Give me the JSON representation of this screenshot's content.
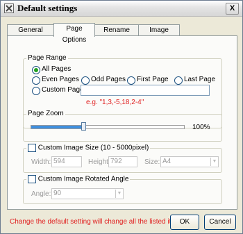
{
  "window": {
    "title": "Default settings",
    "close_label": "X"
  },
  "tabs": [
    {
      "label": "General Options"
    },
    {
      "label": "Page Options"
    },
    {
      "label": "Rename Options"
    },
    {
      "label": "Image Options"
    }
  ],
  "page_range": {
    "title": "Page Range",
    "options": {
      "all_pages": "All Pages",
      "even_pages": "Even Pages",
      "odd_pages": "Odd Pages",
      "first_page": "First Page",
      "last_page": "Last Page",
      "custom_pages": "Custom Pages"
    },
    "selected": "all_pages",
    "custom_value": "",
    "hint": "e.g. \"1,3,-5,18,2-4\""
  },
  "page_zoom": {
    "title": "Page Zoom",
    "value": 100,
    "value_label": "100%"
  },
  "custom_image_size": {
    "title": "Custom Image Size (10 - 5000pixel)",
    "checked": false,
    "width_label": "Width:",
    "width_value": "594",
    "height_label": "Height:",
    "height_value": "792",
    "size_label": "Size:",
    "size_value": "A4"
  },
  "custom_rotated_angle": {
    "title": "Custom Image Rotated Angle",
    "checked": false,
    "angle_label": "Angle:",
    "angle_value": "90"
  },
  "footer": {
    "message": "Change the default setting will change all the listed items.",
    "ok_label": "OK",
    "cancel_label": "Cancel"
  },
  "colors": {
    "accent": "#3f8fdf",
    "warning_text": "#e02020",
    "radio_selected": "#21a121"
  },
  "icons": {
    "title_icon": "settings-x-icon"
  }
}
